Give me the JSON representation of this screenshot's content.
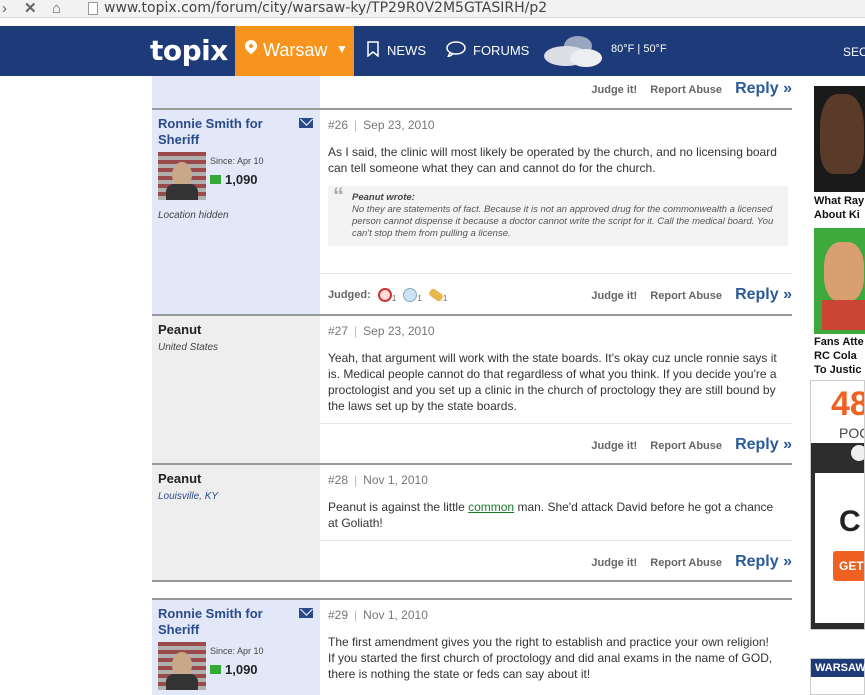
{
  "browser": {
    "url": "www.topix.com/forum/city/warsaw-ky/TP29R0V2M5GTASIRH/p2"
  },
  "header": {
    "logo": "topix",
    "city": "Warsaw",
    "nav": {
      "news": "NEWS",
      "forums": "FORUMS"
    },
    "weather": "80°F | 50°F",
    "section_cut": "SEC"
  },
  "actions": {
    "judge": "Judge it!",
    "report": "Report Abuse",
    "reply": "Reply »"
  },
  "posts": [
    {
      "author": "Ronnie Smith for Sheriff",
      "since": "Since: Apr 10",
      "count": "1,090",
      "location": "Location hidden",
      "number": "#26",
      "date": "Sep 23, 2010",
      "text": "As I said, the clinic will most likely be operated by the church, and no licensing board can tell someone what they can and cannot do for the church.",
      "quote_author": "Peanut wrote:",
      "quote_text": "No they are statements of fact. Because it is not an approved drug for the commonwealth a licensed person cannot dispense it because a doctor cannot write the script for it. Call the medical board. You can't stop them from pulling a license.",
      "judged_label": "Judged:",
      "judged_counts": [
        "1",
        "1",
        "1"
      ]
    },
    {
      "author": "Peanut",
      "location": "United States",
      "number": "#27",
      "date": "Sep 23, 2010",
      "text": "Yeah, that argument will work with the state boards. It's okay cuz uncle ronnie says it is. Medical people cannot do that regardless of what you think. If you decide you're a proctologist and you set up a clinic in the church of proctology they are still bound by the laws set up by the state boards."
    },
    {
      "author": "Peanut",
      "location": "Louisville, KY",
      "number": "#28",
      "date": "Nov 1, 2010",
      "text_before": "Peanut is against the little ",
      "text_link": "common",
      "text_after": " man. She'd attack David before he got a chance at Goliath!"
    },
    {
      "author": "Ronnie Smith for Sheriff",
      "since": "Since: Apr 10",
      "count": "1,090",
      "number": "#29",
      "date": "Nov 1, 2010",
      "text1": "The first amendment gives you the right to establish and practice your own religion!",
      "text2": "If you started the first church of proctology and did anal exams in the name of GOD, there is nothing the state or feds can say about it!"
    }
  ],
  "ads": {
    "ad1_caption": [
      "What Ray",
      "About Ki"
    ],
    "ad2_caption": [
      "Fans Atte",
      "RC Cola",
      "To Justic"
    ],
    "ad3_big": "48",
    "ad3_poc": "POC",
    "ad3_ch": "C",
    "ad3_get": "GET",
    "warsaw_box": "WARSAW"
  }
}
